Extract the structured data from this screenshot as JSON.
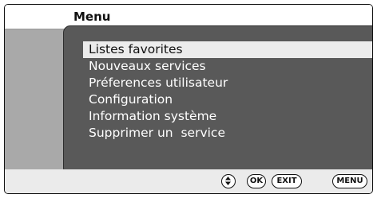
{
  "header": {
    "title": "Menu"
  },
  "menu": {
    "items": [
      {
        "label": "Listes favorites",
        "selected": true
      },
      {
        "label": "Nouveaux services",
        "selected": false
      },
      {
        "label": "Préferences utilisateur",
        "selected": false
      },
      {
        "label": "Configuration",
        "selected": false
      },
      {
        "label": "Information système",
        "selected": false
      },
      {
        "label": "Supprimer un  service",
        "selected": false
      }
    ]
  },
  "footer": {
    "nav_icon": "up-down-navigation-icon",
    "keys": {
      "ok": "OK",
      "exit": "EXIT",
      "menu": "MENU"
    }
  },
  "colors": {
    "panel": "#595959",
    "side_band": "#a9a9a9",
    "highlight": "#ececec",
    "background": "#ebebeb"
  }
}
